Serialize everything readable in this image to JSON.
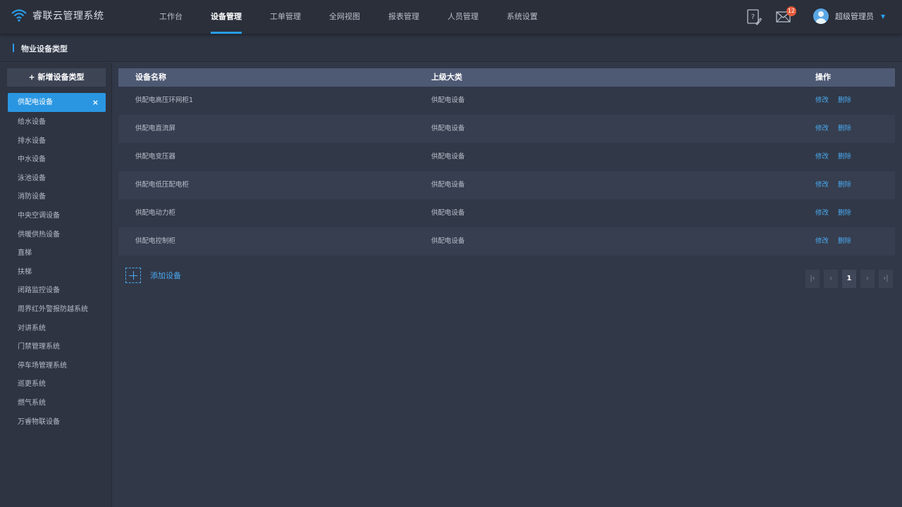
{
  "app": {
    "title": "睿联云管理系统"
  },
  "nav": {
    "items": [
      "工作台",
      "设备管理",
      "工单管理",
      "全网视图",
      "报表管理",
      "人员管理",
      "系统设置"
    ],
    "active_index": 1
  },
  "header": {
    "help_icon": "help-edit-icon",
    "mail_icon": "mail-icon",
    "mail_badge": "12",
    "user_name": "超级管理员",
    "caret": "▼"
  },
  "breadcrumb": {
    "title": "物业设备类型"
  },
  "sidebar": {
    "add_label": "+ 新增设备类型",
    "active_item": {
      "label": "供配电设备",
      "close": "×"
    },
    "items": [
      "给水设备",
      "排水设备",
      "中水设备",
      "泳池设备",
      "消防设备",
      "中央空调设备",
      "供暖供热设备",
      "直梯",
      "扶梯",
      "闭路监控设备",
      "周界红外警报防越系统",
      "对讲系统",
      "门禁管理系统",
      "停车场管理系统",
      "巡更系统",
      "燃气系统",
      "万睿物联设备"
    ]
  },
  "table": {
    "columns": [
      "设备名称",
      "上级大类",
      "操作"
    ],
    "edit_label": "修改",
    "delete_label": "删除",
    "rows": [
      {
        "name": "供配电高压环网柜1",
        "parent": "供配电设备"
      },
      {
        "name": "供配电直流屏",
        "parent": "供配电设备"
      },
      {
        "name": "供配电变压器",
        "parent": "供配电设备"
      },
      {
        "name": "供配电低压配电柜",
        "parent": "供配电设备"
      },
      {
        "name": "供配电动力柜",
        "parent": "供配电设备"
      },
      {
        "name": "供配电控制柜",
        "parent": "供配电设备"
      }
    ]
  },
  "add_device": {
    "label": "添加设备"
  },
  "pagination": {
    "first": "|‹",
    "prev": "‹",
    "current": "1",
    "next": "›",
    "last": "›|"
  },
  "colors": {
    "accent": "#2a9ce8",
    "link": "#4aa8ee",
    "badge": "#e45a3a"
  }
}
